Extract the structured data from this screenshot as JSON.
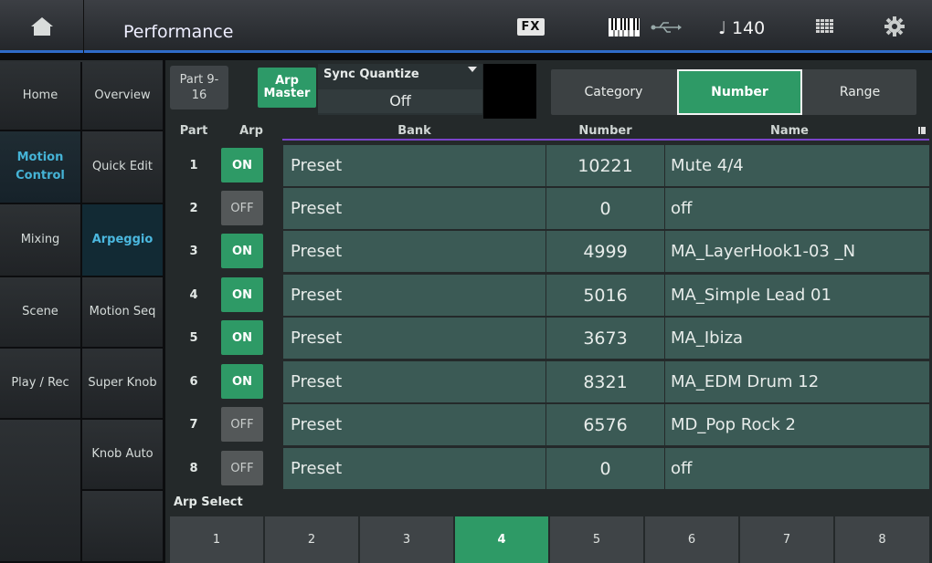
{
  "header": {
    "title": "Performance",
    "fx_label": "FX",
    "tempo": "140",
    "icons": [
      "home-icon",
      "keyboard-icon",
      "usb-icon",
      "note-icon",
      "grid-icon",
      "gear-icon"
    ]
  },
  "nav": {
    "col1": [
      {
        "label": "Home"
      },
      {
        "label": "Motion Control",
        "selected": true
      },
      {
        "label": "Mixing"
      },
      {
        "label": "Scene"
      },
      {
        "label": "Play / Rec"
      },
      {
        "label": ""
      }
    ],
    "col2": [
      {
        "label": "Overview"
      },
      {
        "label": "Quick Edit"
      },
      {
        "label": "Arpeggio",
        "selected": true
      },
      {
        "label": "Motion Seq"
      },
      {
        "label": "Super Knob"
      },
      {
        "label": "Knob Auto"
      }
    ]
  },
  "controls": {
    "part_range": "Part 9-16",
    "arp_master": "Arp Master",
    "sync_quantize_label": "Sync Quantize",
    "sync_quantize_value": "Off",
    "tabs": [
      "Category",
      "Number",
      "Range"
    ],
    "active_tab": "Number"
  },
  "table": {
    "headers": {
      "part": "Part",
      "arp": "Arp",
      "bank": "Bank",
      "number": "Number",
      "name": "Name"
    },
    "rows": [
      {
        "part": "1",
        "arp": "ON",
        "bank": "Preset",
        "number": "10221",
        "name": "Mute 4/4"
      },
      {
        "part": "2",
        "arp": "OFF",
        "bank": "Preset",
        "number": "0",
        "name": "off"
      },
      {
        "part": "3",
        "arp": "ON",
        "bank": "Preset",
        "number": "4999",
        "name": "MA_LayerHook1-03 _N"
      },
      {
        "part": "4",
        "arp": "ON",
        "bank": "Preset",
        "number": "5016",
        "name": "MA_Simple Lead 01"
      },
      {
        "part": "5",
        "arp": "ON",
        "bank": "Preset",
        "number": "3673",
        "name": "MA_Ibiza"
      },
      {
        "part": "6",
        "arp": "ON",
        "bank": "Preset",
        "number": "8321",
        "name": "MA_EDM Drum 12"
      },
      {
        "part": "7",
        "arp": "OFF",
        "bank": "Preset",
        "number": "6576",
        "name": "MD_Pop Rock 2"
      },
      {
        "part": "8",
        "arp": "OFF",
        "bank": "Preset",
        "number": "0",
        "name": "off"
      }
    ]
  },
  "arp_select": {
    "label": "Arp Select",
    "options": [
      "1",
      "2",
      "3",
      "4",
      "5",
      "6",
      "7",
      "8"
    ],
    "active": "4"
  },
  "colors": {
    "accent_green": "#2e9a66",
    "highlight_blue": "#45b3d6",
    "header_line": "#7a44c9",
    "top_line": "#2f6bc9"
  }
}
